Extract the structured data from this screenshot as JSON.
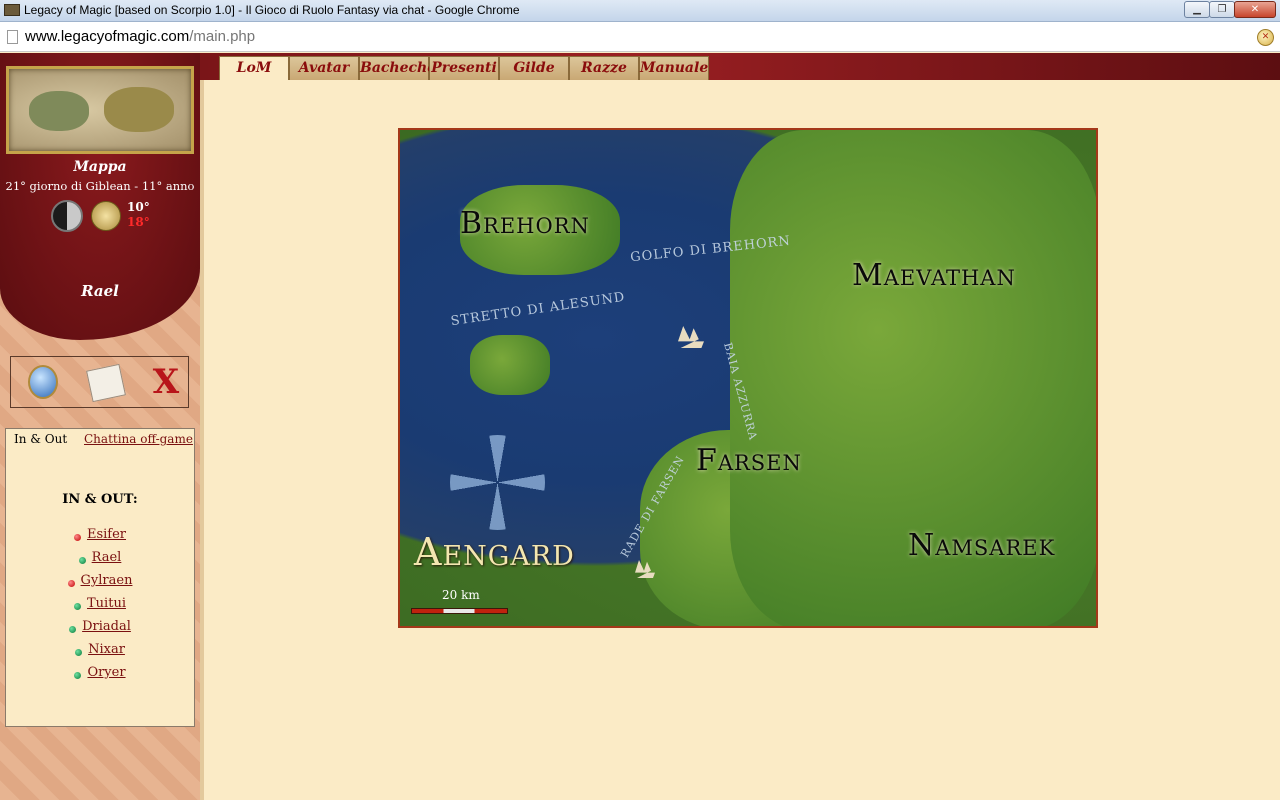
{
  "window": {
    "title": "Legacy of Magic [based on Scorpio 1.0] - Il Gioco di Ruolo Fantasy via chat - Google Chrome",
    "minimize": "▁",
    "maximize": "❐",
    "close": "✕"
  },
  "address": {
    "host": "www.legacyofmagic.com",
    "path": "/main.php"
  },
  "nav": {
    "tabs": [
      {
        "label": "LoM"
      },
      {
        "label": "Avatar"
      },
      {
        "label": "Bacheche"
      },
      {
        "label": "Presenti"
      },
      {
        "label": "Gilde"
      },
      {
        "label": "Razze"
      },
      {
        "label": "Manuale"
      }
    ]
  },
  "sidebar": {
    "map_caption": "Mappa",
    "date": "21° giorno di Giblean - 11° anno",
    "temp_max": "10°",
    "temp_min": "18°",
    "username": "Rael",
    "logout_glyph": "X"
  },
  "chat": {
    "tab_inout": "In & Out",
    "tab_chattina": "Chattina off-game",
    "heading": "IN & OUT:",
    "users": [
      {
        "name": "Esifer",
        "status": "red"
      },
      {
        "name": "Rael",
        "status": "green"
      },
      {
        "name": "Gylraen",
        "status": "red"
      },
      {
        "name": "Tuitui",
        "status": "green"
      },
      {
        "name": "Driadal",
        "status": "green"
      },
      {
        "name": "Nixar",
        "status": "green"
      },
      {
        "name": "Oryer",
        "status": "green"
      }
    ]
  },
  "map": {
    "regions": {
      "brehorn": "Brehorn",
      "maevathan": "Maevathan",
      "farsen": "Farsen",
      "namsarek": "Namsarek",
      "aengard": "Aengard"
    },
    "seas": {
      "golfo_brehorn": "Golfo di Brehorn",
      "stretto_alesund": "Stretto di Alesund",
      "baia_azzurra": "Baia Azzurra",
      "rade_farsen": "Rade di Farsen"
    },
    "scale": "20 km"
  }
}
